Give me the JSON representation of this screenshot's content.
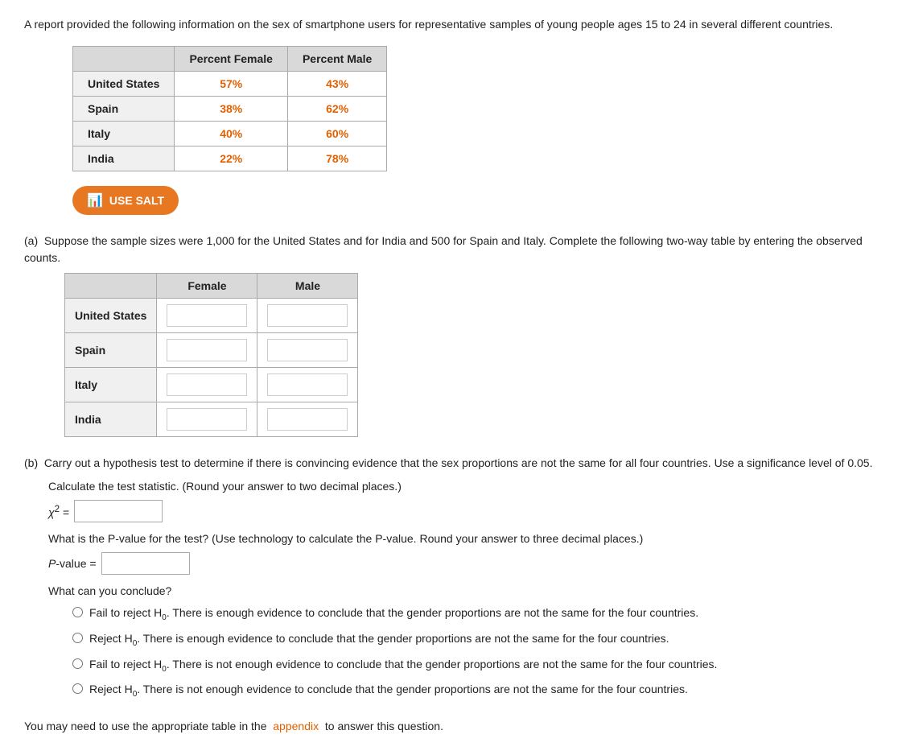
{
  "intro": {
    "text": "A report provided the following information on the sex of smartphone users for representative samples of young people ages 15 to 24 in several different countries."
  },
  "data_table": {
    "headers": [
      "",
      "Percent Female",
      "Percent Male"
    ],
    "rows": [
      {
        "country": "United States",
        "female": "57%",
        "male": "43%"
      },
      {
        "country": "Spain",
        "female": "38%",
        "male": "62%"
      },
      {
        "country": "Italy",
        "female": "40%",
        "male": "60%"
      },
      {
        "country": "India",
        "female": "22%",
        "male": "78%"
      }
    ]
  },
  "use_salt_button": "USE SALT",
  "part_a": {
    "label": "(a)",
    "text": "Suppose the sample sizes were 1,000 for the United States and for India and 500 for Spain and Italy. Complete the following two-way table by entering the observed counts.",
    "table_headers": [
      "",
      "Female",
      "Male"
    ],
    "rows": [
      "United States",
      "Spain",
      "Italy",
      "India"
    ]
  },
  "part_b": {
    "label": "(b)",
    "text": "Carry out a hypothesis test to determine if there is convincing evidence that the sex proportions are not the same for all four countries. Use a significance level of 0.05.",
    "calc_instruction": "Calculate the test statistic. (Round your answer to two decimal places.)",
    "chi_label": "χ² =",
    "pvalue_instruction": "What is the P-value for the test? (Use technology to calculate the P-value. Round your answer to three decimal places.)",
    "pvalue_label": "P-value =",
    "conclude_label": "What can you conclude?",
    "radio_options": [
      "Fail to reject H₀. There is enough evidence to conclude that the gender proportions are not the same for the four countries.",
      "Reject H₀. There is enough evidence to conclude that the gender proportions are not the same for the four countries.",
      "Fail to reject H₀. There is not enough evidence to conclude that the gender proportions are not the same for the four countries.",
      "Reject H₀. There is not enough evidence to conclude that the gender proportions are not the same for the four countries."
    ]
  },
  "footer": {
    "text": "You may need to use the appropriate table in the",
    "link_text": "appendix",
    "text2": "to answer this question."
  }
}
